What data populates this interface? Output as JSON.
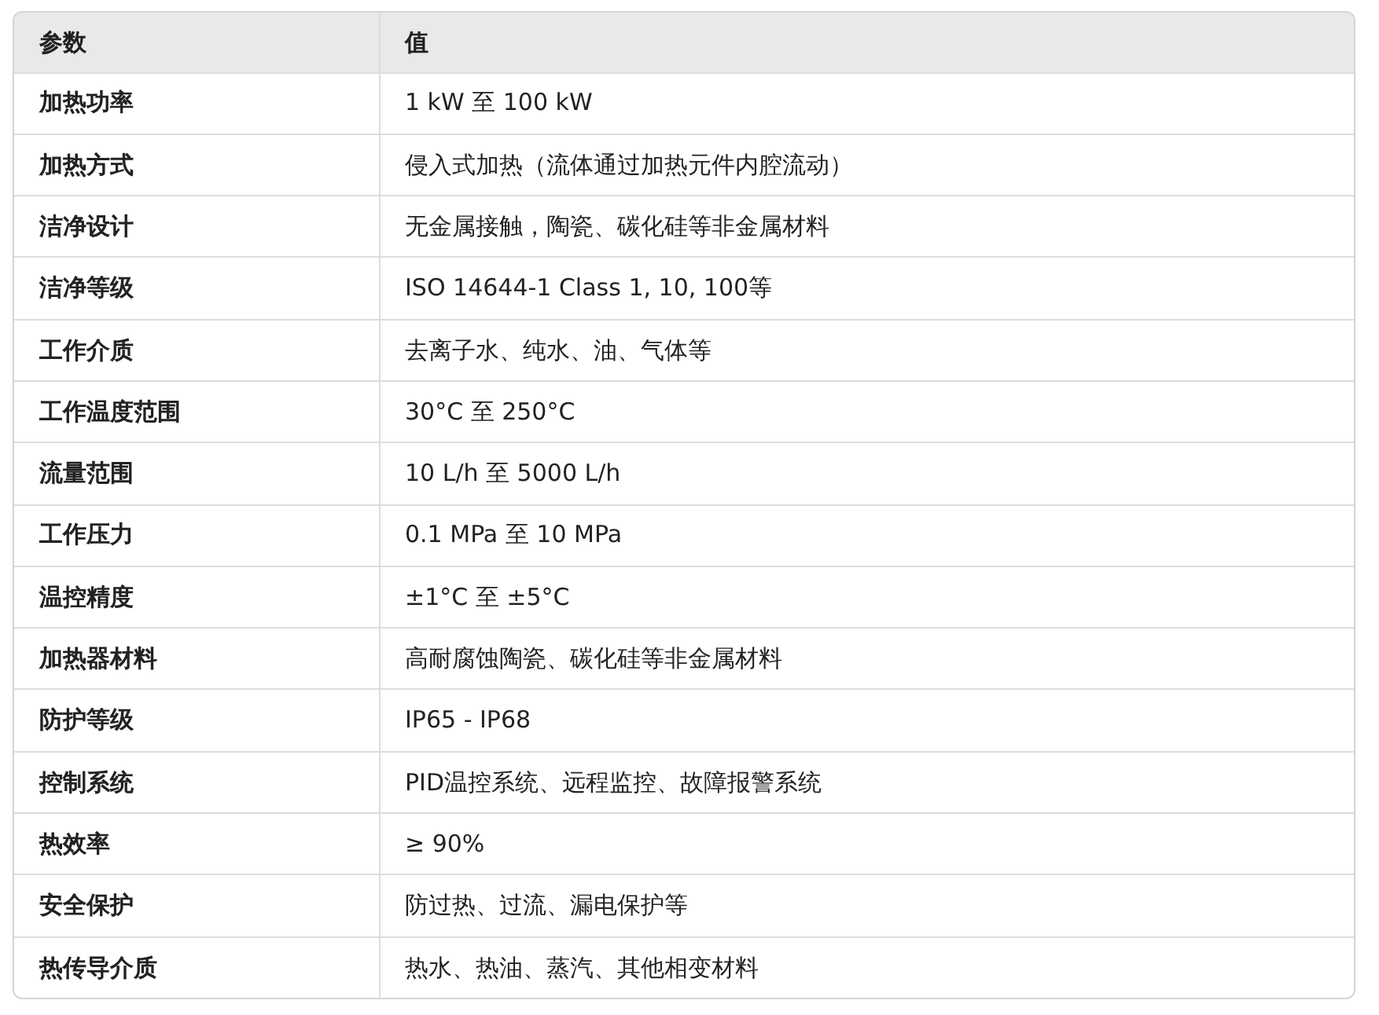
{
  "table": {
    "columns": [
      "参数",
      "值"
    ],
    "rows": [
      [
        "加热功率",
        "1 kW 至 100 kW"
      ],
      [
        "加热方式",
        "侵入式加热（流体通过加热元件内腔流动）"
      ],
      [
        "洁净设计",
        "无金属接触，陶瓷、碳化硅等非金属材料"
      ],
      [
        "洁净等级",
        "ISO 14644-1 Class 1, 10, 100等"
      ],
      [
        "工作介质",
        "去离子水、纯水、油、气体等"
      ],
      [
        "工作温度范围",
        "30°C 至 250°C"
      ],
      [
        "流量范围",
        "10 L/h 至 5000 L/h"
      ],
      [
        "工作压力",
        "0.1 MPa 至 10 MPa"
      ],
      [
        "温控精度",
        "±1°C 至 ±5°C"
      ],
      [
        "加热器材料",
        "高耐腐蚀陶瓷、碳化硅等非金属材料"
      ],
      [
        "防护等级",
        "IP65 - IP68"
      ],
      [
        "控制系统",
        "PID温控系统、远程监控、故障报警系统"
      ],
      [
        "热效率",
        "≥ 90%"
      ],
      [
        "安全保护",
        "防过热、过流、漏电保护等"
      ],
      [
        "热传导介质",
        "热水、热油、蒸汽、其他相变材料"
      ]
    ]
  }
}
